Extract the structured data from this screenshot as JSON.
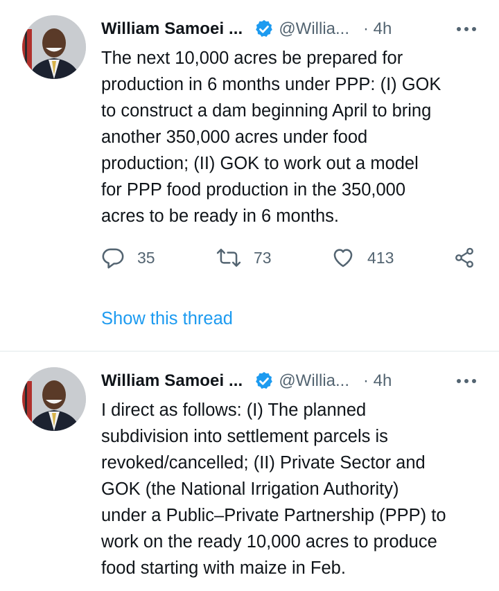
{
  "colors": {
    "accent": "#1d9bf0",
    "secondary_text": "#536471",
    "primary_text": "#0f1419",
    "divider": "#eff3f4"
  },
  "tweets": [
    {
      "display_name": "William Samoei ...",
      "handle": "@Willia...",
      "time": "· 4h",
      "text": "The next 10,000 acres be prepared for\nproduction in 6 months under PPP: (I) GOK\nto construct a dam beginning April to bring\nanother 350,000 acres under food\nproduction; (II) GOK to work out a model\nfor PPP food production in the 350,000\nacres to be ready in 6 months.",
      "reply_count": "35",
      "retweet_count": "73",
      "like_count": "413",
      "show_thread": "Show this thread",
      "icons": {
        "verified": "verified-badge-icon",
        "more": "more-icon",
        "reply": "reply-icon",
        "retweet": "retweet-icon",
        "like": "heart-icon",
        "share": "share-icon"
      }
    },
    {
      "display_name": "William Samoei ...",
      "handle": "@Willia...",
      "time": "· 4h",
      "text": "I direct as follows: (I) The planned\nsubdivision into settlement parcels is\nrevoked/cancelled; (II) Private Sector and\nGOK (the National Irrigation Authority)\nunder a Public–Private Partnership (PPP) to\nwork on the ready 10,000 acres to produce\nfood starting with maize in Feb."
    }
  ]
}
